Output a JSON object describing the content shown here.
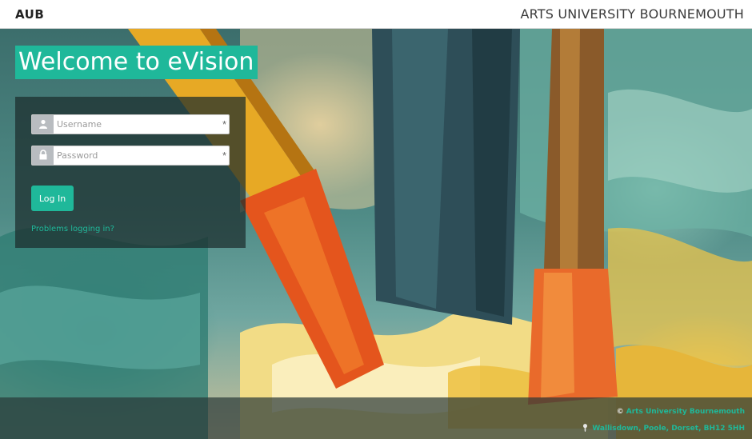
{
  "header": {
    "logo": "AUB",
    "university": "ARTS UNIVERSITY BOURNEMOUTH"
  },
  "welcome": "Welcome to eVision",
  "login": {
    "username_placeholder": "Username",
    "password_placeholder": "Password",
    "required_marker": "*",
    "login_button": "Log In",
    "problems_link": "Problems logging in?"
  },
  "footer": {
    "copyright_symbol": "©",
    "university_link": "Arts University Bournemouth",
    "pin_icon": "map-pin-icon",
    "address": "Wallisdown, Poole, Dorset, BH12 5HH"
  },
  "colors": {
    "accent": "#1fb89a"
  }
}
